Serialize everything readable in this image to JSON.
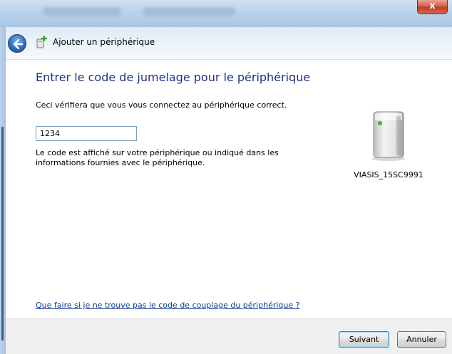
{
  "window": {
    "close_label": "x"
  },
  "header": {
    "title": "Ajouter un périphérique"
  },
  "content": {
    "heading": "Entrer le code de jumelage pour le périphérique",
    "description": "Ceci vérifiera que vous vous connectez au périphérique correct.",
    "code_value": "1234",
    "hint": "Le code est affiché sur votre périphérique ou indiqué dans les informations fournies avec le périphérique.",
    "device_name": "VIASIS_15SC9991",
    "help_link": "Que faire si je ne trouve pas le code de couplage du périphérique ?"
  },
  "footer": {
    "next_label": "Suivant",
    "cancel_label": "Annuler"
  },
  "colors": {
    "heading": "#1e3287",
    "link": "#0f3c96",
    "close_button": "#c23b22"
  },
  "icons": {
    "back": "back-arrow-icon",
    "wizard": "add-device-icon",
    "device": "device-icon"
  }
}
